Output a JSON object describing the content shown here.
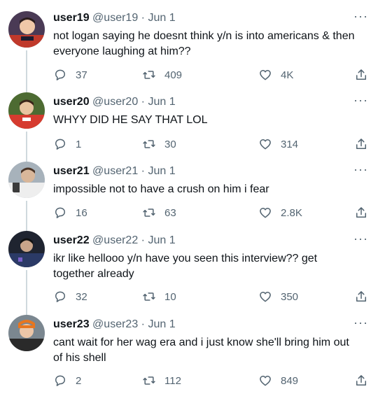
{
  "tweets": [
    {
      "name": "user19",
      "handle": "@user19",
      "date": "Jun 1",
      "text": "not logan saying he doesnt think y/n is into americans & then everyone laughing at him??",
      "replies": "37",
      "retweets": "409",
      "likes": "4K",
      "avatar_colors": [
        "#3b2a3f",
        "#c0392b",
        "#f0c8a8"
      ]
    },
    {
      "name": "user20",
      "handle": "@user20",
      "date": "Jun 1",
      "text": "WHYY DID HE SAY THAT LOL",
      "replies": "1",
      "retweets": "30",
      "likes": "314",
      "avatar_colors": [
        "#3f5b2a",
        "#d63b2f",
        "#e8c4a0"
      ]
    },
    {
      "name": "user21",
      "handle": "@user21",
      "date": "Jun 1",
      "text": "impossible not to have a crush on him i fear",
      "replies": "16",
      "retweets": "63",
      "likes": "2.8K",
      "avatar_colors": [
        "#9aa6b0",
        "#e8e8e8",
        "#d9b79a"
      ]
    },
    {
      "name": "user22",
      "handle": "@user22",
      "date": "Jun 1",
      "text": "ikr like hellooo y/n have you seen this interview?? get together already",
      "replies": "32",
      "retweets": "10",
      "likes": "350",
      "avatar_colors": [
        "#1a1f2b",
        "#2b3a66",
        "#c9a58a"
      ]
    },
    {
      "name": "user23",
      "handle": "@user23",
      "date": "Jun 1",
      "text": "cant wait for her wag era and i just know she'll bring him out of his shell",
      "replies": "2",
      "retweets": "112",
      "likes": "849",
      "avatar_colors": [
        "#6f7c86",
        "#e8761f",
        "#ecc6a8"
      ]
    }
  ],
  "more_label": "···",
  "colors": {
    "text": "#0f1419",
    "secondary": "#536471",
    "thread_line": "#cfd9de"
  },
  "icons": [
    "reply-icon",
    "retweet-icon",
    "like-icon",
    "share-icon",
    "more-icon"
  ]
}
